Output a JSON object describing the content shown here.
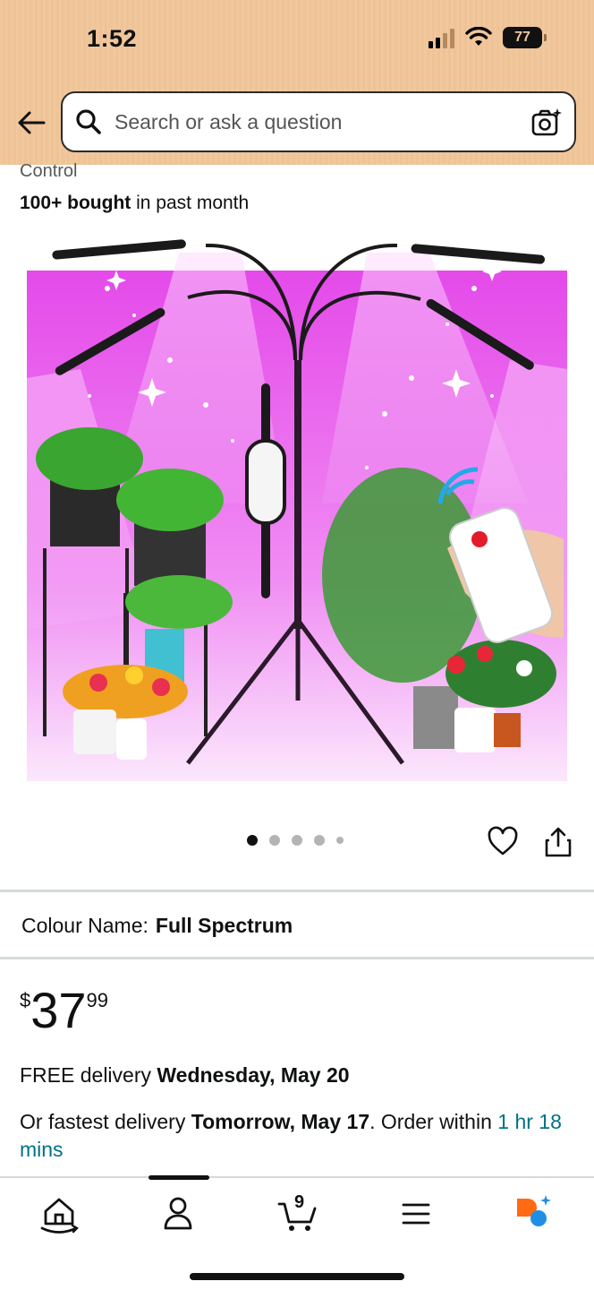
{
  "status_bar": {
    "time": "1:52",
    "battery": "77"
  },
  "search": {
    "placeholder": "Search or ask a question"
  },
  "product": {
    "title_fragment": "Control",
    "bought_bold": "100+ bought",
    "bought_rest": " in past month",
    "image_dots": 5,
    "active_dot": 0
  },
  "colour": {
    "label": "Colour Name:",
    "value": "Full Spectrum"
  },
  "price": {
    "currency": "$",
    "whole": "37",
    "fraction": "99"
  },
  "delivery": {
    "free_prefix": "FREE delivery ",
    "free_date": "Wednesday, May 20",
    "fast_prefix": "Or fastest delivery ",
    "fast_date": "Tomorrow, May 17",
    "order_within": ". Order within ",
    "countdown": "1 hr 18 mins"
  },
  "bottom_nav": {
    "items": [
      "home-icon",
      "account-icon",
      "cart-icon",
      "menu-icon",
      "rufus-icon"
    ],
    "cart_count": "9"
  },
  "colors": {
    "header": "#f1c79c",
    "teal_link": "#007185",
    "rufus_orange": "#ff6a13",
    "rufus_blue": "#1f8fe6"
  }
}
